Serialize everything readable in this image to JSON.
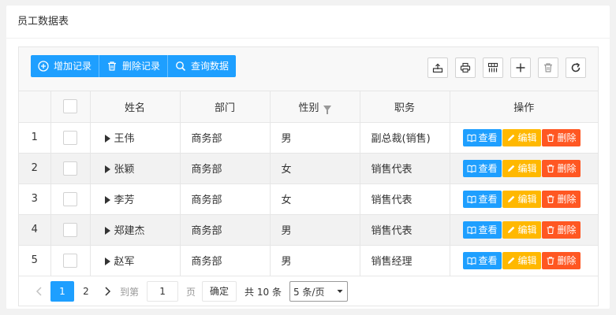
{
  "card": {
    "title": "员工数据表"
  },
  "toolbar": {
    "buttons": [
      {
        "label": "增加记录",
        "icon": "plus-circle-icon"
      },
      {
        "label": "删除记录",
        "icon": "trash-icon"
      },
      {
        "label": "查询数据",
        "icon": "search-icon"
      }
    ],
    "tools": [
      "export-icon",
      "print-icon",
      "columns-icon",
      "plus-icon",
      "trash-icon",
      "refresh-icon"
    ]
  },
  "table": {
    "headers": {
      "name": "姓名",
      "dept": "部门",
      "gender": "性别",
      "position": "职务",
      "ops": "操作"
    },
    "rows": [
      {
        "index": "1",
        "name": "王伟",
        "dept": "商务部",
        "gender": "男",
        "position": "副总裁(销售)"
      },
      {
        "index": "2",
        "name": "张颖",
        "dept": "商务部",
        "gender": "女",
        "position": "销售代表"
      },
      {
        "index": "3",
        "name": "李芳",
        "dept": "商务部",
        "gender": "女",
        "position": "销售代表"
      },
      {
        "index": "4",
        "name": "郑建杰",
        "dept": "商务部",
        "gender": "男",
        "position": "销售代表"
      },
      {
        "index": "5",
        "name": "赵军",
        "dept": "商务部",
        "gender": "男",
        "position": "销售经理"
      }
    ],
    "actions": {
      "view": "查看",
      "edit": "编辑",
      "delete": "删除"
    }
  },
  "pager": {
    "pages": [
      "1",
      "2"
    ],
    "current_page": "1",
    "goto_label": "到第",
    "goto_value": "1",
    "page_unit": "页",
    "confirm_label": "确定",
    "total_text": "共 10 条",
    "page_size": "5 条/页"
  },
  "colors": {
    "primary": "#1e9fff",
    "warn": "#ffb800",
    "danger": "#ff5722"
  }
}
